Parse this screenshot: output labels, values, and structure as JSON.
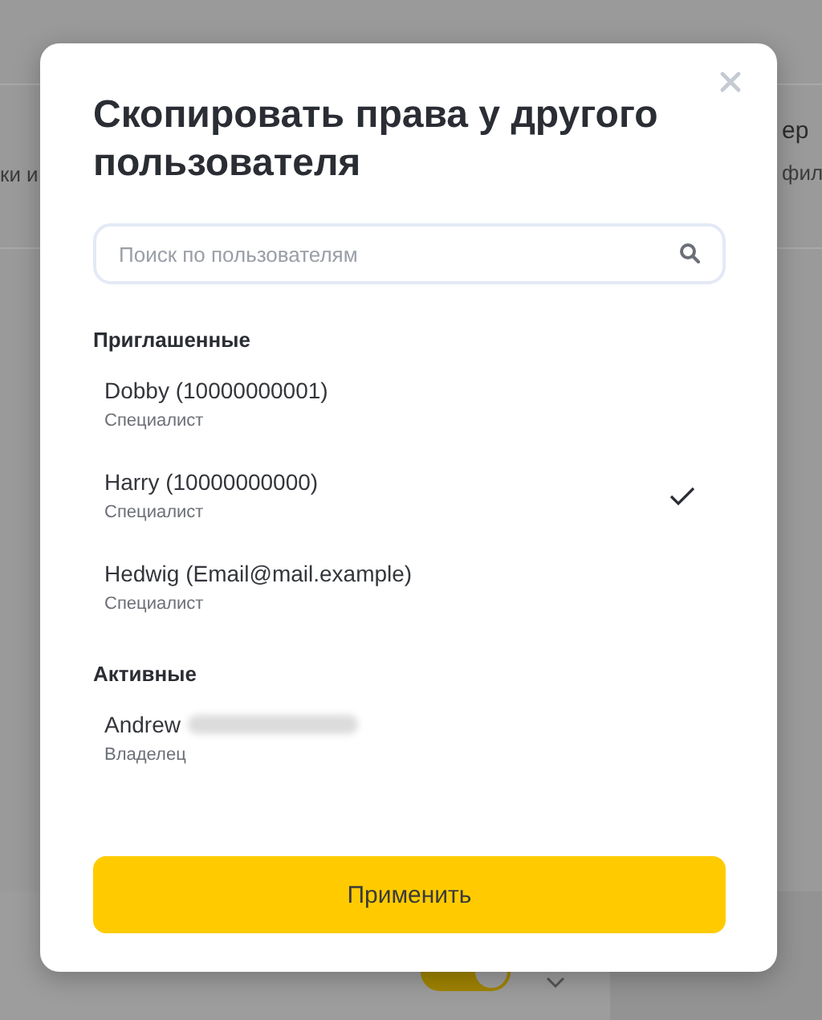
{
  "background": {
    "left_text": "ки и",
    "right_title": "ер",
    "right_text": "фил",
    "toggle": {
      "on": true
    }
  },
  "dialog": {
    "title": "Скопировать права у другого пользователя",
    "search": {
      "placeholder": "Поиск по пользователям"
    },
    "sections": [
      {
        "title": "Приглашенные",
        "users": [
          {
            "name": "Dobby (10000000001)",
            "role": "Специалист",
            "selected": false
          },
          {
            "name": "Harry (10000000000)",
            "role": "Специалист",
            "selected": true
          },
          {
            "name": "Hedwig (Email@mail.example)",
            "role": "Специалист",
            "selected": false
          }
        ]
      },
      {
        "title": "Активные",
        "users": [
          {
            "name": "Andrew",
            "role": "Владелец",
            "selected": false,
            "redacted": true
          }
        ]
      }
    ],
    "apply_button": "Применить"
  }
}
